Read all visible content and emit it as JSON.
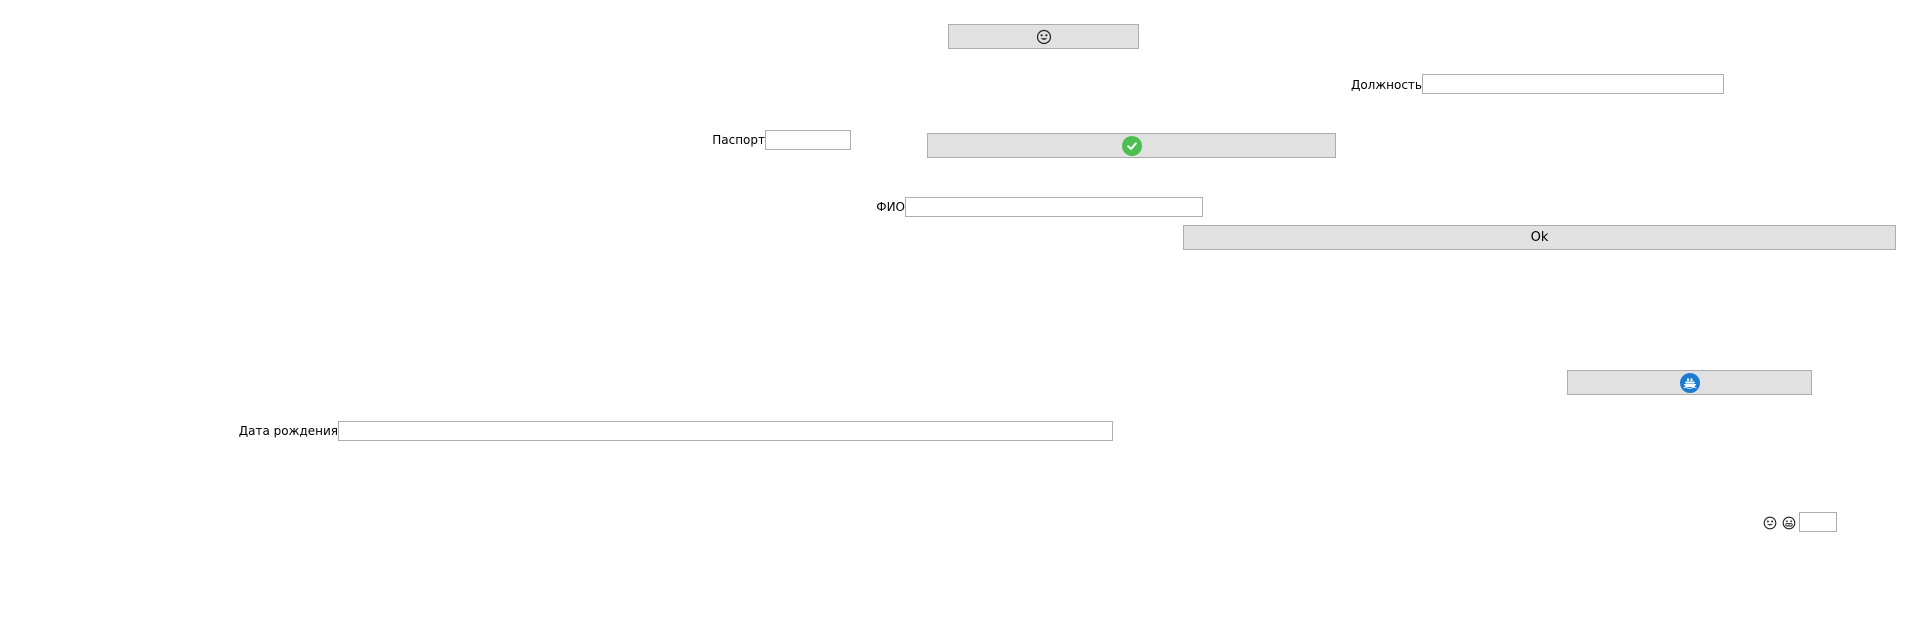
{
  "form": {
    "face_button": {
      "icon": "face-icon"
    },
    "position": {
      "label": "Должность",
      "value": ""
    },
    "passport": {
      "label": "Паспорт",
      "value": ""
    },
    "check_button": {
      "icon": "check-circle-icon",
      "color": "#4cbf4f"
    },
    "fio": {
      "label": "ФИО",
      "value": ""
    },
    "ok_button": {
      "label": "Ok"
    },
    "ship_button": {
      "icon": "ship-icon",
      "color": "#1a7ccf"
    },
    "birth_date": {
      "label": "Дата рождения",
      "value": ""
    },
    "bottom_right": {
      "icons": [
        "face-icon",
        "grin-face-icon"
      ],
      "value": ""
    }
  }
}
